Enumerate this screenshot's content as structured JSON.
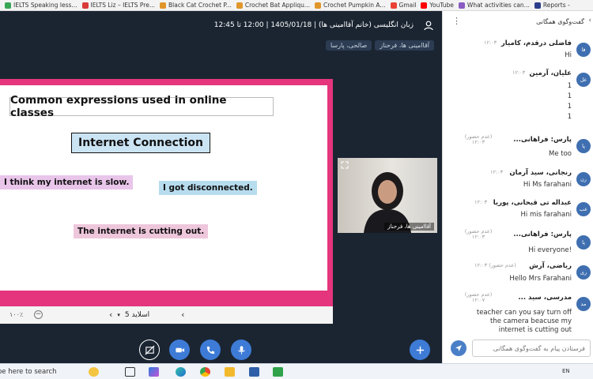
{
  "bookmarks": [
    {
      "label": "IELTS Speaking less...",
      "color": "#3aa655"
    },
    {
      "label": "IELTS Liz – IELTS Pre...",
      "color": "#d93b3b"
    },
    {
      "label": "Black Cat Crochet P...",
      "color": "#e0962a"
    },
    {
      "label": "Crochet Bat Appliqu...",
      "color": "#e0962a"
    },
    {
      "label": "Crochet Pumpkin A...",
      "color": "#e0962a"
    },
    {
      "label": "Gmail",
      "color": "#ea4335"
    },
    {
      "label": "YouTube",
      "color": "#ff0000"
    },
    {
      "label": "What activities can...",
      "color": "#8a5cc2"
    },
    {
      "label": "Reports -",
      "color": "#2c3e8a"
    }
  ],
  "conference": {
    "title": "زبان انگلیسی (خانم آقاامینی ها) | 1405/01/18 | 12:00 تا 12:45",
    "tags": [
      "آقاامینی ها، فرحناز",
      "صالحی، پارسا"
    ]
  },
  "slide": {
    "heading": "Common expressions used in online classes",
    "subheading": "Internet Connection",
    "note1": "I think my internet is slow.",
    "note2": "I got disconnected.",
    "note3": "The internet is cutting out.",
    "zoom": "۱۰۰٪",
    "zoom_control": "−",
    "page_label": "اسلاید 5"
  },
  "video": {
    "participant": "آقاامینی ها، فرحناز"
  },
  "chat": {
    "title": "گفت‌وگوی همگانی",
    "input_placeholder": "فرستادن پیام به گفت‌وگوی همگانی",
    "messages": [
      {
        "avatar": "فا",
        "name": "فاضلی درقدم، کامیار",
        "time": "۱۲:۰۳",
        "lines": [
          "Hi"
        ]
      },
      {
        "avatar": "عل",
        "name": "علیان، آرمین",
        "time": "۱۲:۰۳",
        "lines": [
          "1",
          "1",
          "1",
          "1"
        ]
      },
      {
        "avatar": "پا",
        "name": "پارس: فراهانی...",
        "time": "(عدم حضور) ۱۲:۰۳",
        "lines": [
          "Me too"
        ]
      },
      {
        "avatar": "رن",
        "name": "رنجانی، سید آرمان",
        "time": "۱۲:۰۳",
        "lines": [
          "Hi Ms farahani"
        ]
      },
      {
        "avatar": "عب",
        "name": "عبداله تی قبحانی، پوریا",
        "time": "۱۲:۰۳",
        "lines": [
          "Hi mis farahani"
        ]
      },
      {
        "avatar": "پا",
        "name": "پارس: فراهانی...",
        "time": "(عدم حضور) ۱۲:۰۳",
        "lines": [
          "Hi everyone!"
        ]
      },
      {
        "avatar": "ری",
        "name": "ریاضی، آرش",
        "time": "(عدم حضور) ۱۲:۰۳",
        "lines": [
          "Hello Mrs Farahani"
        ]
      },
      {
        "avatar": "مد",
        "name": "مدرسی، سید ...",
        "time": "(عدم حضور) ۱۲:۰۷",
        "lines": [
          "teacher can you say turn off the camera beacuse my internet is cutting out"
        ]
      }
    ]
  },
  "taskbar": {
    "search_text": "Type here to search",
    "language": "EN"
  },
  "colors": {
    "slide_border": "#e4357d",
    "control_blue": "#3d7bd6",
    "background": "#1b2532"
  }
}
